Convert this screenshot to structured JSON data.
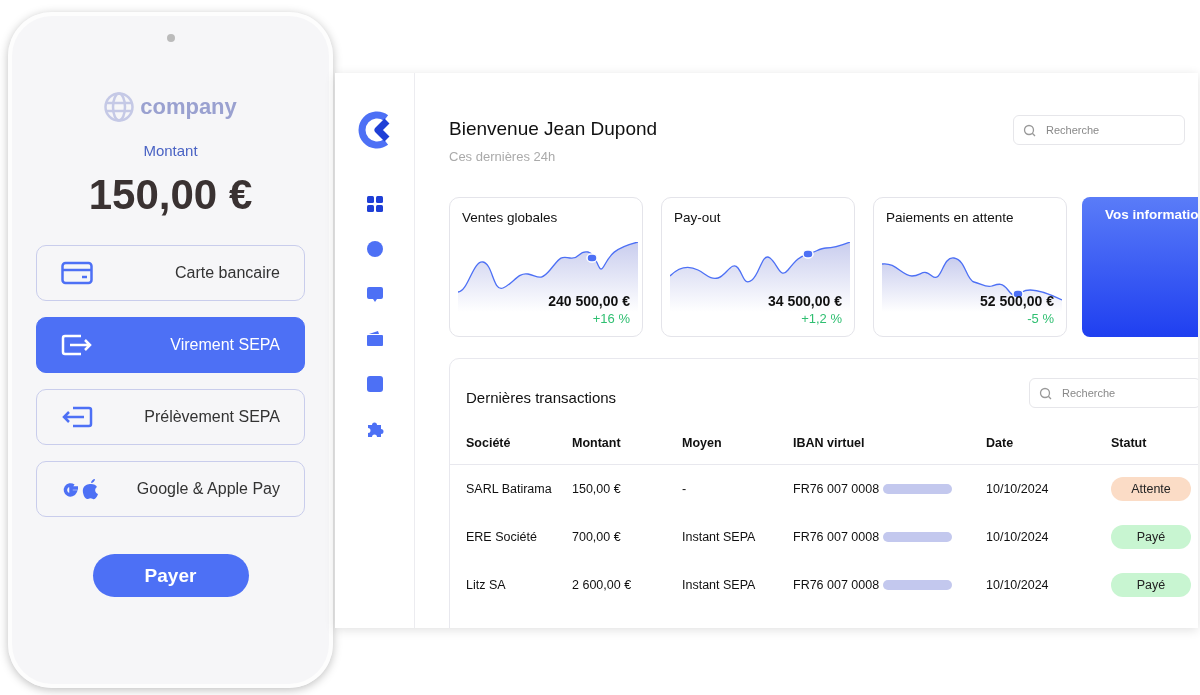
{
  "phone": {
    "logo": "company",
    "amount_label": "Montant",
    "amount": "150,00 €",
    "payment_methods": [
      {
        "label": "Carte bancaire",
        "selected": false
      },
      {
        "label": "Virement SEPA",
        "selected": true
      },
      {
        "label": "Prélèvement SEPA",
        "selected": false
      },
      {
        "label": "Google & Apple Pay",
        "selected": false
      }
    ],
    "pay_button": "Payer"
  },
  "dashboard": {
    "sidebar": {
      "items": [
        {
          "selected": true
        },
        {
          "selected": false
        },
        {
          "selected": false
        },
        {
          "selected": false
        },
        {
          "selected": false
        },
        {
          "selected": false
        }
      ]
    },
    "greeting": "Bienvenue Jean Dupond",
    "subtitle": "Ces dernières 24h",
    "search": {
      "placeholder": "Recherche"
    },
    "cards": [
      {
        "title": "Ventes globales",
        "value": "240 500,00 €",
        "change": "+16 %"
      },
      {
        "title": "Pay-out",
        "value": "34 500,00 €",
        "change": "+1,2 %"
      },
      {
        "title": "Paiements en attente",
        "value": "52 500,00 €",
        "change": "-5 %"
      }
    ],
    "info_card": {
      "title": "Vos informatio"
    },
    "transactions": {
      "title": "Dernières transactions",
      "search": {
        "placeholder": "Recherche"
      },
      "columns": [
        "Société",
        "Montant",
        "Moyen",
        "IBAN virtuel",
        "Date",
        "Statut"
      ],
      "rows": [
        {
          "company": "SARL Batirama",
          "amount": "150,00 €",
          "method": "-",
          "iban": "FR76 007 0008",
          "date": "10/10/2024",
          "status": "Attente",
          "color": "#fbdcc6"
        },
        {
          "company": "ERE Société",
          "amount": "700,00 €",
          "method": "Instant SEPA",
          "iban": "FR76 007 0008",
          "date": "10/10/2024",
          "status": "Payé",
          "color": "#c8f5d1"
        },
        {
          "company": "Litz SA",
          "amount": "2 600,00 €",
          "method": "Instant SEPA",
          "iban": "FR76 007 0008",
          "date": "10/10/2024",
          "status": "Payé",
          "color": "#c8f5d1"
        }
      ]
    }
  }
}
